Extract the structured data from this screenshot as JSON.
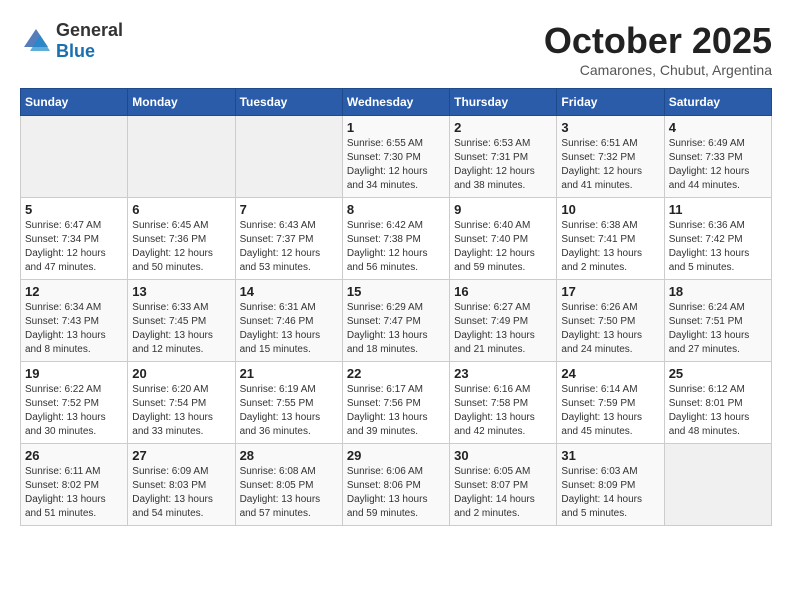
{
  "header": {
    "logo_general": "General",
    "logo_blue": "Blue",
    "month": "October 2025",
    "location": "Camarones, Chubut, Argentina"
  },
  "days_of_week": [
    "Sunday",
    "Monday",
    "Tuesday",
    "Wednesday",
    "Thursday",
    "Friday",
    "Saturday"
  ],
  "weeks": [
    [
      {
        "day": "",
        "info": ""
      },
      {
        "day": "",
        "info": ""
      },
      {
        "day": "",
        "info": ""
      },
      {
        "day": "1",
        "info": "Sunrise: 6:55 AM\nSunset: 7:30 PM\nDaylight: 12 hours\nand 34 minutes."
      },
      {
        "day": "2",
        "info": "Sunrise: 6:53 AM\nSunset: 7:31 PM\nDaylight: 12 hours\nand 38 minutes."
      },
      {
        "day": "3",
        "info": "Sunrise: 6:51 AM\nSunset: 7:32 PM\nDaylight: 12 hours\nand 41 minutes."
      },
      {
        "day": "4",
        "info": "Sunrise: 6:49 AM\nSunset: 7:33 PM\nDaylight: 12 hours\nand 44 minutes."
      }
    ],
    [
      {
        "day": "5",
        "info": "Sunrise: 6:47 AM\nSunset: 7:34 PM\nDaylight: 12 hours\nand 47 minutes."
      },
      {
        "day": "6",
        "info": "Sunrise: 6:45 AM\nSunset: 7:36 PM\nDaylight: 12 hours\nand 50 minutes."
      },
      {
        "day": "7",
        "info": "Sunrise: 6:43 AM\nSunset: 7:37 PM\nDaylight: 12 hours\nand 53 minutes."
      },
      {
        "day": "8",
        "info": "Sunrise: 6:42 AM\nSunset: 7:38 PM\nDaylight: 12 hours\nand 56 minutes."
      },
      {
        "day": "9",
        "info": "Sunrise: 6:40 AM\nSunset: 7:40 PM\nDaylight: 12 hours\nand 59 minutes."
      },
      {
        "day": "10",
        "info": "Sunrise: 6:38 AM\nSunset: 7:41 PM\nDaylight: 13 hours\nand 2 minutes."
      },
      {
        "day": "11",
        "info": "Sunrise: 6:36 AM\nSunset: 7:42 PM\nDaylight: 13 hours\nand 5 minutes."
      }
    ],
    [
      {
        "day": "12",
        "info": "Sunrise: 6:34 AM\nSunset: 7:43 PM\nDaylight: 13 hours\nand 8 minutes."
      },
      {
        "day": "13",
        "info": "Sunrise: 6:33 AM\nSunset: 7:45 PM\nDaylight: 13 hours\nand 12 minutes."
      },
      {
        "day": "14",
        "info": "Sunrise: 6:31 AM\nSunset: 7:46 PM\nDaylight: 13 hours\nand 15 minutes."
      },
      {
        "day": "15",
        "info": "Sunrise: 6:29 AM\nSunset: 7:47 PM\nDaylight: 13 hours\nand 18 minutes."
      },
      {
        "day": "16",
        "info": "Sunrise: 6:27 AM\nSunset: 7:49 PM\nDaylight: 13 hours\nand 21 minutes."
      },
      {
        "day": "17",
        "info": "Sunrise: 6:26 AM\nSunset: 7:50 PM\nDaylight: 13 hours\nand 24 minutes."
      },
      {
        "day": "18",
        "info": "Sunrise: 6:24 AM\nSunset: 7:51 PM\nDaylight: 13 hours\nand 27 minutes."
      }
    ],
    [
      {
        "day": "19",
        "info": "Sunrise: 6:22 AM\nSunset: 7:52 PM\nDaylight: 13 hours\nand 30 minutes."
      },
      {
        "day": "20",
        "info": "Sunrise: 6:20 AM\nSunset: 7:54 PM\nDaylight: 13 hours\nand 33 minutes."
      },
      {
        "day": "21",
        "info": "Sunrise: 6:19 AM\nSunset: 7:55 PM\nDaylight: 13 hours\nand 36 minutes."
      },
      {
        "day": "22",
        "info": "Sunrise: 6:17 AM\nSunset: 7:56 PM\nDaylight: 13 hours\nand 39 minutes."
      },
      {
        "day": "23",
        "info": "Sunrise: 6:16 AM\nSunset: 7:58 PM\nDaylight: 13 hours\nand 42 minutes."
      },
      {
        "day": "24",
        "info": "Sunrise: 6:14 AM\nSunset: 7:59 PM\nDaylight: 13 hours\nand 45 minutes."
      },
      {
        "day": "25",
        "info": "Sunrise: 6:12 AM\nSunset: 8:01 PM\nDaylight: 13 hours\nand 48 minutes."
      }
    ],
    [
      {
        "day": "26",
        "info": "Sunrise: 6:11 AM\nSunset: 8:02 PM\nDaylight: 13 hours\nand 51 minutes."
      },
      {
        "day": "27",
        "info": "Sunrise: 6:09 AM\nSunset: 8:03 PM\nDaylight: 13 hours\nand 54 minutes."
      },
      {
        "day": "28",
        "info": "Sunrise: 6:08 AM\nSunset: 8:05 PM\nDaylight: 13 hours\nand 57 minutes."
      },
      {
        "day": "29",
        "info": "Sunrise: 6:06 AM\nSunset: 8:06 PM\nDaylight: 13 hours\nand 59 minutes."
      },
      {
        "day": "30",
        "info": "Sunrise: 6:05 AM\nSunset: 8:07 PM\nDaylight: 14 hours\nand 2 minutes."
      },
      {
        "day": "31",
        "info": "Sunrise: 6:03 AM\nSunset: 8:09 PM\nDaylight: 14 hours\nand 5 minutes."
      },
      {
        "day": "",
        "info": ""
      }
    ]
  ]
}
